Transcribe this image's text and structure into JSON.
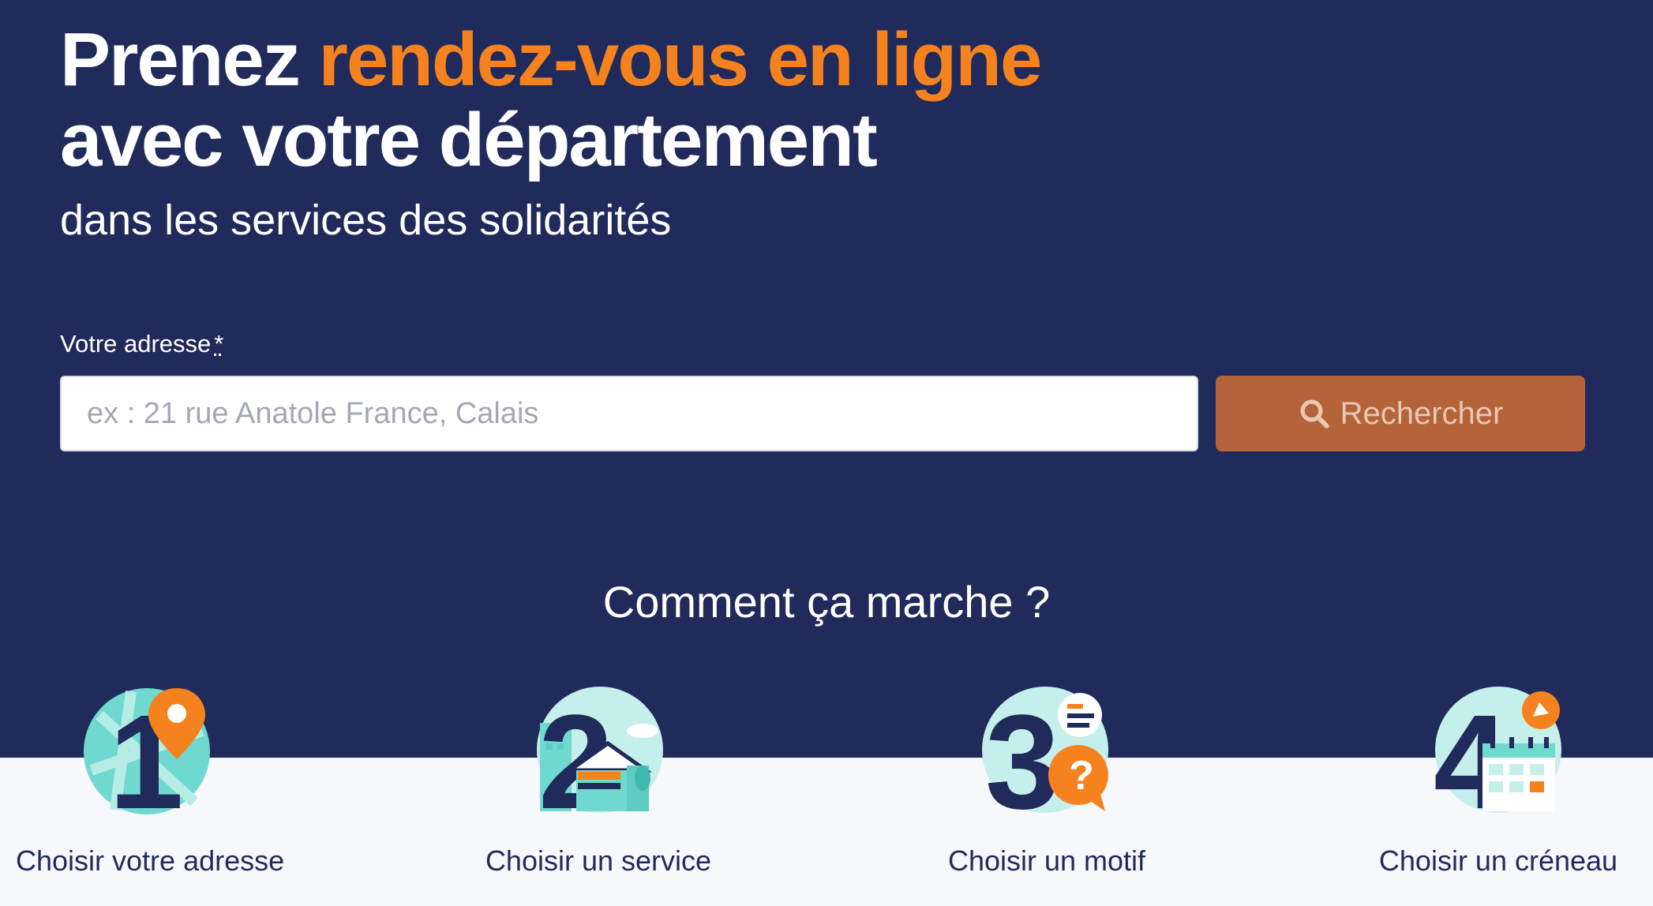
{
  "hero": {
    "title_prefix": "Prenez",
    "title_accent": "rendez-vous en ligne",
    "title_line2": "avec votre département",
    "subtitle": "dans les services des solidarités"
  },
  "search": {
    "label": "Votre adresse",
    "required_mark": "*",
    "placeholder": "ex : 21 rue Anatole France, Calais",
    "value": "",
    "button_label": "Rechercher",
    "button_icon": "search-icon"
  },
  "how_it_works": {
    "title": "Comment ça marche ?",
    "steps": [
      {
        "number": "1",
        "label": "Choisir votre adresse",
        "icon": "map-pin-icon"
      },
      {
        "number": "2",
        "label": "Choisir un service",
        "icon": "building-icon"
      },
      {
        "number": "3",
        "label": "Choisir un motif",
        "icon": "question-bubble-icon"
      },
      {
        "number": "4",
        "label": "Choisir un créneau",
        "icon": "calendar-icon"
      }
    ]
  },
  "colors": {
    "navy": "#212b5b",
    "orange": "#f5821f",
    "button_brown": "#b5643a",
    "teal": "#6fd8cf",
    "light_bg": "#f7f8fc"
  }
}
